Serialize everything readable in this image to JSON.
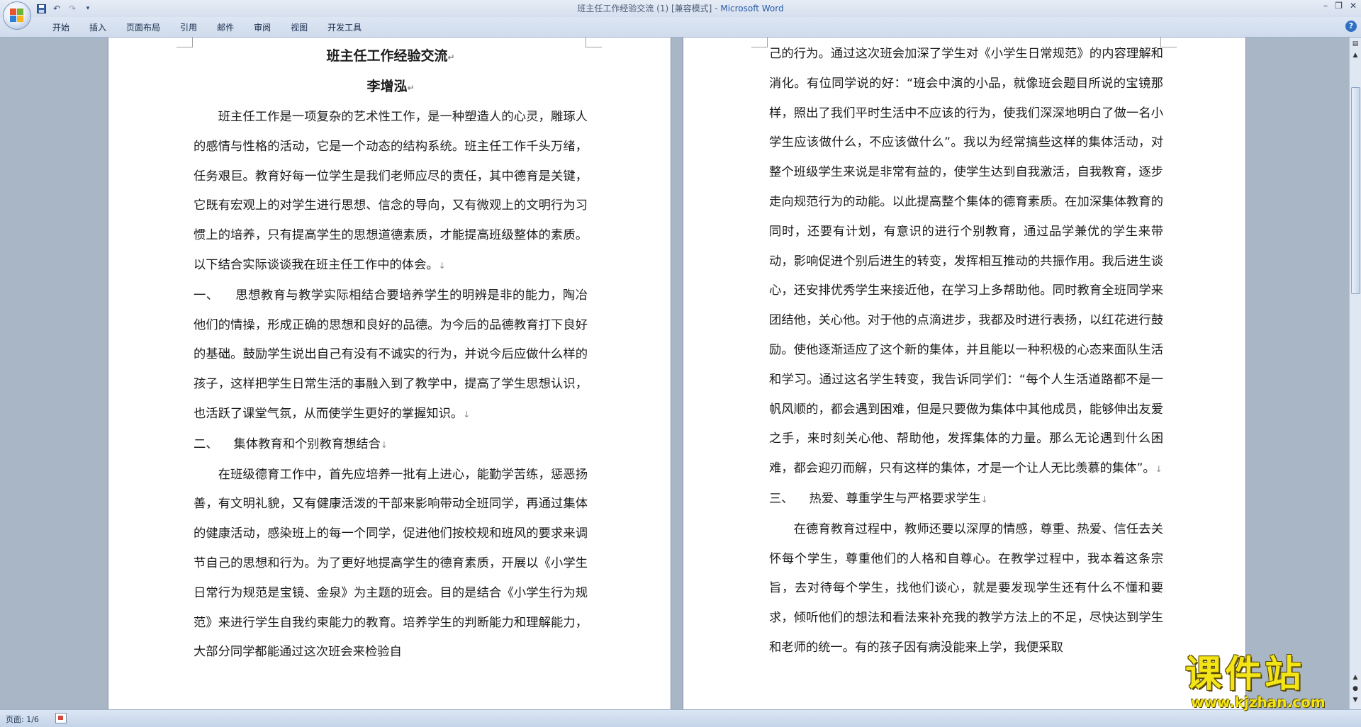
{
  "window": {
    "title": "班主任工作经验交流 (1) [兼容模式]",
    "app_name": "Microsoft Word",
    "controls": [
      "–",
      "❐",
      "✕"
    ]
  },
  "quick_access": [
    "save-icon",
    "undo-icon",
    "redo-icon",
    "customize-icon"
  ],
  "ribbon": {
    "tabs": [
      "开始",
      "插入",
      "页面布局",
      "引用",
      "邮件",
      "审阅",
      "视图",
      "开发工具"
    ]
  },
  "document": {
    "left_page": {
      "title": "班主任工作经验交流",
      "author": "李增泓",
      "p1": "班主任工作是一项复杂的艺术性工作，是一种塑造人的心灵，雕琢人的感情与性格的活动，它是一个动态的结构系统。班主任工作千头万绪，任务艰巨。教育好每一位学生是我们老师应尽的责任，其中德育是关键，它既有宏观上的对学生进行思想、信念的导向，又有微观上的文明行为习惯上的培养，只有提高学生的思想道德素质，才能提高班级整体的素质。以下结合实际谈谈我在班主任工作中的体会。",
      "h1": "一、    思想教育与教学实际相结合要培养学生的明辨是非的能力，陶冶他们的情操，形成正确的思想和良好的品德。为今后的品德教育打下良好的基础。鼓励学生说出自己有没有不诚实的行为，并说今后应做什么样的孩子，这样把学生日常生活的事融入到了教学中，提高了学生思想认识，也活跃了课堂气氛，从而使学生更好的掌握知识。",
      "h2": "二、    集体教育和个别教育想结合",
      "p2": "在班级德育工作中，首先应培养一批有上进心，能勤学苦练，惩恶扬善，有文明礼貌，又有健康活泼的干部来影响带动全班同学，再通过集体的健康活动，感染班上的每一个同学，促进他们按校规和班风的要求来调节自己的思想和行为。为了更好地提高学生的德育素质，开展以《小学生日常行为规范是宝镜、金泉》为主题的班会。目的是结合《小学生行为规范》来进行学生自我约束能力的教育。培养学生的判断能力和理解能力，大部分同学都能通过这次班会来检验自"
    },
    "right_page": {
      "p1": "己的行为。通过这次班会加深了学生对《小学生日常规范》的内容理解和消化。有位同学说的好：“班会中演的小品，就像班会题目所说的宝镜那样，照出了我们平时生活中不应该的行为，使我们深深地明白了做一名小学生应该做什么，不应该做什么”。我以为经常搞些这样的集体活动，对整个班级学生来说是非常有益的，使学生达到自我激活，自我教育，逐步走向规范行为的动能。以此提高整个集体的德育素质。在加深集体教育的同时，还要有计划，有意识的进行个别教育，通过品学兼优的学生来带动，影响促进个别后进生的转变，发挥相互推动的共振作用。我后进生谈心，还安排优秀学生来接近他，在学习上多帮助他。同时教育全班同学来团结他，关心他。对于他的点滴进步，我都及时进行表扬，以红花进行鼓励。使他逐渐适应了这个新的集体，并且能以一种积极的心态来面队生活和学习。通过这名学生转变，我告诉同学们：“每个人生活道路都不是一帆风顺的，都会遇到困难，但是只要做为集体中其他成员，能够伸出友爱之手，来时刻关心他、帮助他，发挥集体的力量。那么无论遇到什么困难，都会迎刃而解，只有这样的集体，才是一个让人无比羡慕的集体”。",
      "h3": "三、    热爱、尊重学生与严格要求学生",
      "p2": "在德育教育过程中，教师还要以深厚的情感，尊重、热爱、信任去关怀每个学生，尊重他们的人格和自尊心。在教学过程中，我本着这条宗旨，去对待每个学生，找他们谈心，就是要发现学生还有什么不懂和要求，倾听他们的想法和看法来补充我的教学方法上的不足，尽快达到学生和老师的统一。有的孩子因有病没能来上学，我便采取"
    },
    "paragraph_mark": "↵",
    "line_break_mark": "↓"
  },
  "statusbar": {
    "page_indicator": "页面: 1/6"
  },
  "watermark": {
    "main": "课件站",
    "sub": "www.kjzhan.com"
  }
}
